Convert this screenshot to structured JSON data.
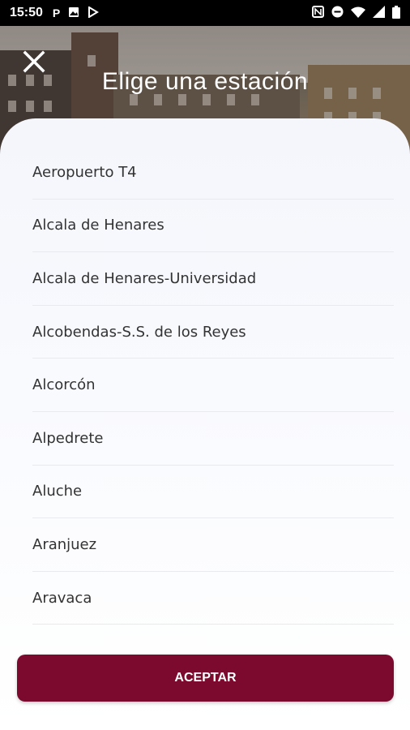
{
  "status_bar": {
    "time": "15:50",
    "left_icons": [
      "parking-icon",
      "image-icon",
      "play-store-icon"
    ],
    "right_icons": [
      "nfc-icon",
      "do-not-disturb-icon",
      "wifi-icon",
      "signal-icon",
      "battery-icon"
    ]
  },
  "header": {
    "title": "Elige una estación",
    "close_icon": "close-icon"
  },
  "stations": [
    "Aeropuerto T4",
    "Alcala de Henares",
    "Alcala de Henares-Universidad",
    "Alcobendas-S.S. de los Reyes",
    "Alcorcón",
    "Alpedrete",
    "Aluche",
    "Aranjuez",
    "Aravaca"
  ],
  "accept_button": {
    "label": "ACEPTAR"
  },
  "colors": {
    "accent": "#7c0a2e",
    "status_bar": "#000000",
    "text": "#333333"
  }
}
